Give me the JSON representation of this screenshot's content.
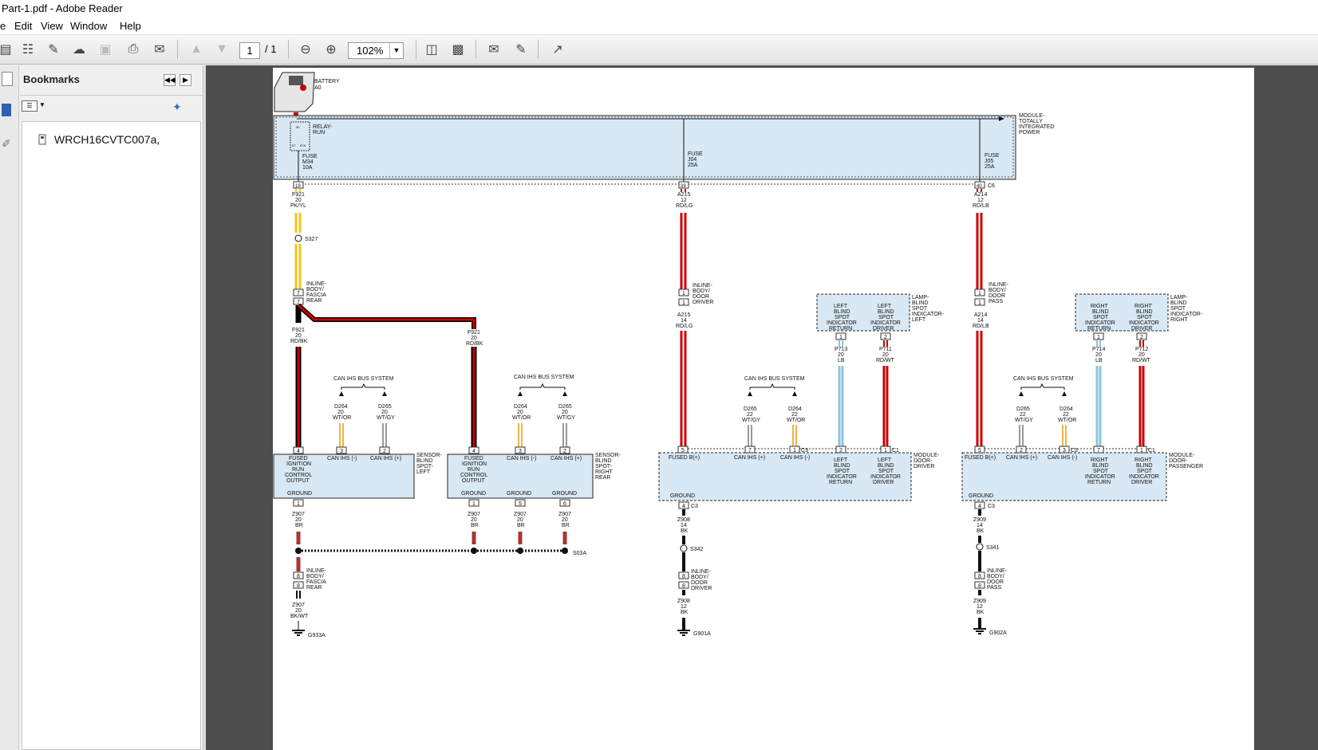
{
  "window": {
    "title": "Part-1.pdf - Adobe Reader"
  },
  "menu": [
    "e",
    "Edit",
    "View",
    "Window",
    "Help"
  ],
  "toolbar": {
    "page_current": "1",
    "page_total": "/ 1",
    "zoom": "102%"
  },
  "icons": [
    "create-pdf-icon",
    "export-icon",
    "edit-icon",
    "upload-icon",
    "save-icon",
    "print-icon",
    "email-icon",
    "page-up-icon",
    "page-down-icon",
    "zoom-out-icon",
    "zoom-in-icon",
    "fit-page-icon",
    "fit-width-icon",
    "comment-icon",
    "sign-icon",
    "fullscreen-icon"
  ],
  "bookmarks": {
    "title": "Bookmarks",
    "items": [
      {
        "label": "WRCH16CVTC007a,"
      }
    ]
  },
  "diagram": {
    "battery": [
      "BATTERY",
      "A0"
    ],
    "tip_module": [
      "MODULE-",
      "TOTALLY",
      "INTEGRATED",
      "POWER"
    ],
    "relay": [
      "RELAY-",
      "RUN"
    ],
    "relay_pins": [
      "30",
      "87",
      "87A"
    ],
    "fuse1": [
      "FUSE",
      "M34",
      "10A"
    ],
    "fuse2": [
      "FUSE",
      "J04",
      "25A"
    ],
    "fuse3": [
      "FUSE",
      "J05",
      "25A"
    ],
    "pins_top": [
      "19",
      "39",
      "40",
      "C6"
    ],
    "w1": [
      "F921",
      "20",
      "PK/YL"
    ],
    "w2": [
      "A215",
      "12",
      "RD/LG"
    ],
    "w3": [
      "A214",
      "12",
      "RD/LB"
    ],
    "s327": "S327",
    "inline_body_fascia_rear": [
      "INLINE-",
      "BODY/",
      "FASCIA",
      "REAR"
    ],
    "inline_body_door_driver": [
      "INLINE-",
      "BODY/",
      "DOOR",
      "DRIVER"
    ],
    "inline_body_door_pass": [
      "INLINE-",
      "BODY/",
      "DOOR",
      "PASS"
    ],
    "pin7": "7",
    "pin1": "1",
    "pin8": "8",
    "f921_rdbk": [
      "F921",
      "20",
      "RD/BK"
    ],
    "a215_14": [
      "A215",
      "14",
      "RD/LG"
    ],
    "a214_14": [
      "A214",
      "14",
      "RD/LB"
    ],
    "can_bus": "CAN IHS BUS SYSTEM",
    "d264_20": [
      "D264",
      "20",
      "WT/OR"
    ],
    "d265_20": [
      "D265",
      "20",
      "WT/GY"
    ],
    "d265_22": [
      "D265",
      "22",
      "WT/GY"
    ],
    "d264_22": [
      "D264",
      "22",
      "WT/OR"
    ],
    "sensor_left": [
      "SENSOR-",
      "BLIND",
      "SPOT-",
      "LEFT"
    ],
    "sensor_right": [
      "SENSOR-",
      "BLIND",
      "SPOT-",
      "RIGHT",
      "REAR"
    ],
    "fused_ign": [
      "FUSED",
      "IGNITION",
      "RUN",
      "CONTROL",
      "OUTPUT"
    ],
    "can_minus": "CAN IHS (-)",
    "can_plus": "CAN IHS (+)",
    "ground": "GROUND",
    "sensor_pins": [
      "4",
      "3",
      "2",
      "1",
      "5",
      "6"
    ],
    "z907": [
      "Z907",
      "20",
      "BR"
    ],
    "z907_bkwt": [
      "Z907",
      "20",
      "BK/WT"
    ],
    "s03a": "S03A",
    "g933a": "G933A",
    "lamp_left": [
      "LAMP-",
      "BLIND",
      "SPOT",
      "INDICATOR-",
      "LEFT"
    ],
    "lamp_right": [
      "LAMP-",
      "BLIND",
      "SPOT",
      "INDICATOR-",
      "RIGHT"
    ],
    "left_return": [
      "LEFT",
      "BLIND",
      "SPOT",
      "INDICATOR",
      "RETURN"
    ],
    "left_driver": [
      "LEFT",
      "BLIND",
      "SPOT",
      "INDICATOR",
      "DRIVER"
    ],
    "right_return": [
      "RIGHT",
      "BLIND",
      "SPOT",
      "INDICATOR",
      "RETURN"
    ],
    "right_driver": [
      "RIGHT",
      "BLIND",
      "SPOT",
      "INDICATOR",
      "DRIVER"
    ],
    "p713": [
      "P713",
      "20",
      "LB"
    ],
    "p711": [
      "P711",
      "20",
      "RD/WT"
    ],
    "p714": [
      "P714",
      "20",
      "LB"
    ],
    "p712": [
      "P712",
      "20",
      "RD/WT"
    ],
    "door_driver": [
      "MODULE-",
      "DOOR-",
      "DRIVER"
    ],
    "door_pass": [
      "MODULE-",
      "DOOR-",
      "PASSENGER"
    ],
    "fused_b": "FUSED B(+)",
    "conn_c1": "C1",
    "conn_c3": "C3",
    "conn_c2": "C2",
    "z908_14": [
      "Z908",
      "14",
      "BK"
    ],
    "z908_12": [
      "Z908",
      "12",
      "BK"
    ],
    "z909_14": [
      "Z909",
      "14",
      "BK"
    ],
    "z909_12": [
      "Z909",
      "12",
      "BK"
    ],
    "s342": "S342",
    "s341": "S341",
    "g901a": "G901A",
    "g902a": "G902A"
  }
}
